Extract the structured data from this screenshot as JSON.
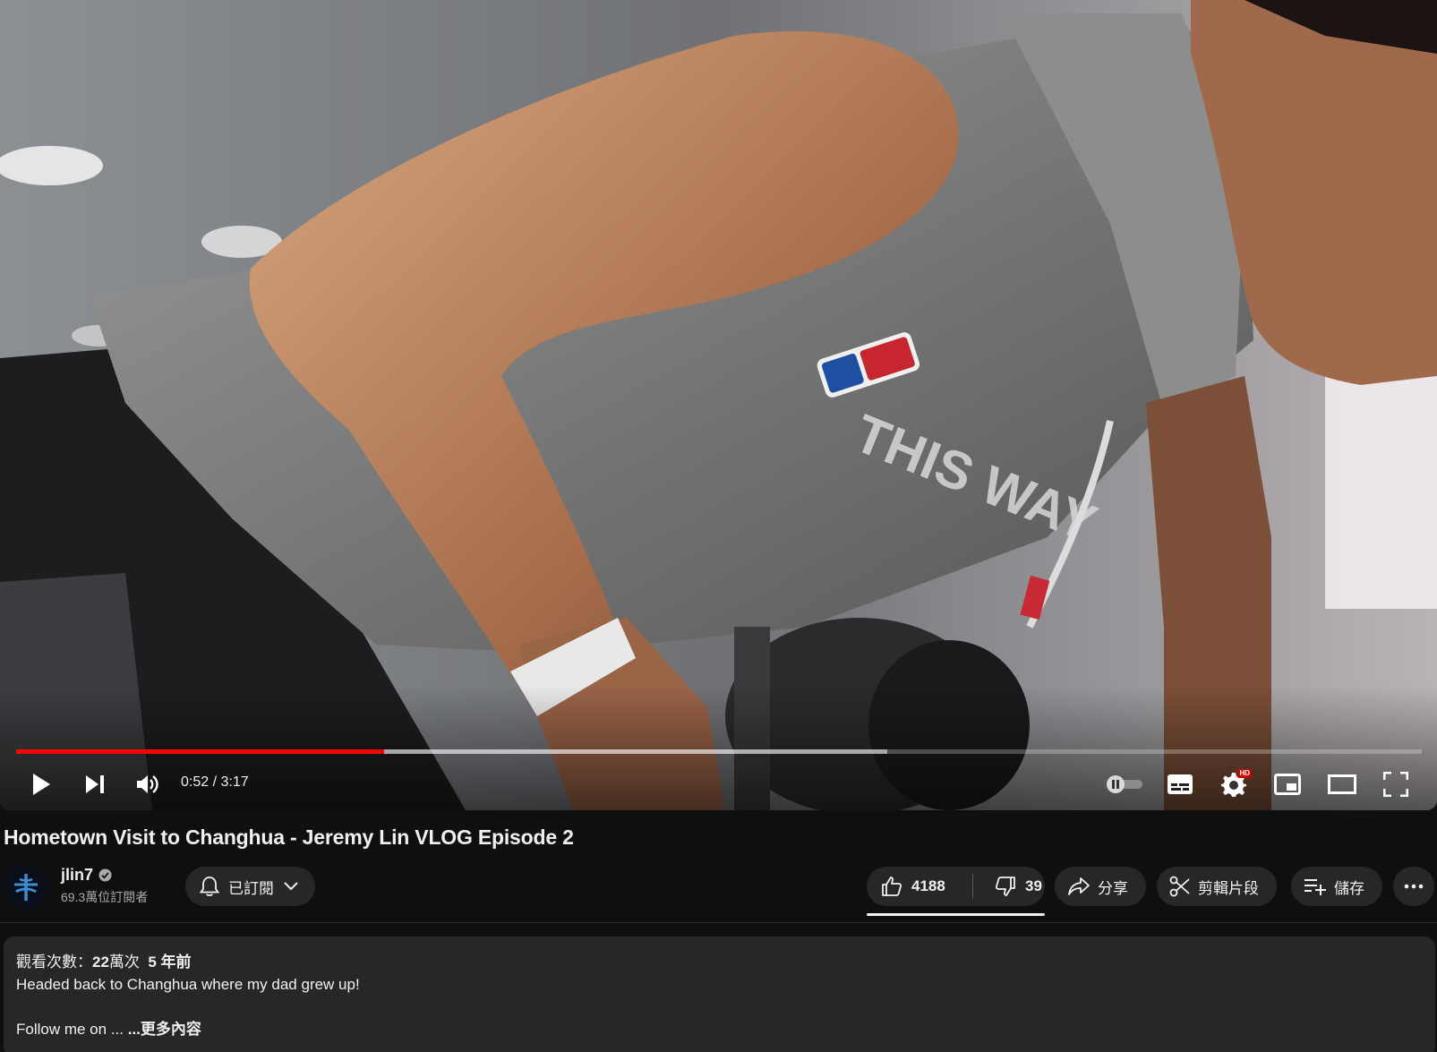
{
  "player": {
    "current_time": "0:52",
    "duration": "3:17",
    "progress_fraction": 0.262,
    "buffered_fraction": 0.62,
    "hd_badge": "HD",
    "accent_color": "#ff0000"
  },
  "video": {
    "title": "Hometown Visit to Changhua - Jeremy Lin VLOG Episode 2"
  },
  "channel": {
    "name": "jlin7",
    "subscribers": "69.3萬位訂閱者",
    "verified_icon": "verified-check-icon"
  },
  "subscribe": {
    "label": "已訂閱"
  },
  "actions": {
    "likes": "4188",
    "dislikes": "39",
    "share_label": "分享",
    "clip_label": "剪輯片段",
    "save_label": "儲存"
  },
  "description": {
    "views_label": "觀看次數：",
    "views_value": "22",
    "views_unit": "萬次",
    "age": "5 年前",
    "line1": "Headed back to Changhua where my dad grew up!",
    "line2": "Follow me on ...",
    "more_label": "...更多內容"
  }
}
